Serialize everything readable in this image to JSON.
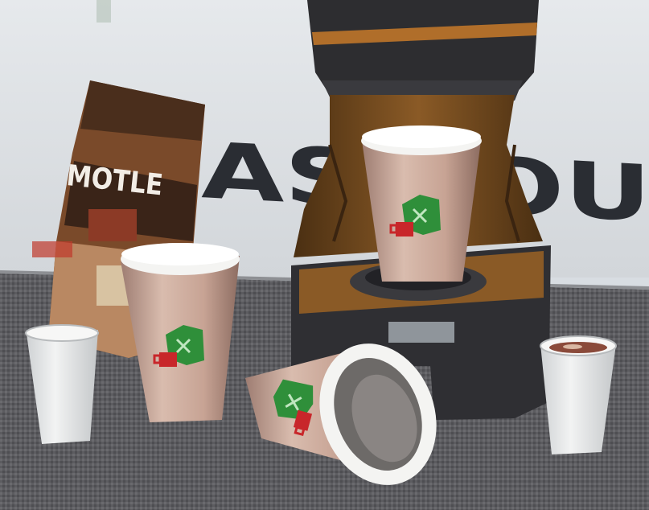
{
  "scene": {
    "kind": "3D game render, pixel-textured",
    "wall_text": "AS YOU",
    "carton_label": "MOTLE",
    "machine_display": ""
  },
  "palette": {
    "wall": "#dde1e5",
    "counter": "#5f5f62",
    "cup_pink": "#c8a89a",
    "lid_white": "#f4f4f2",
    "logo_green": "#2f8f3a",
    "logo_red": "#c8262a",
    "machine_brown": "#6e4a22",
    "machine_dark": "#2c2c2e",
    "carton_brown": "#7a4a2a"
  },
  "icons": [
    "cup-logo-icon"
  ]
}
